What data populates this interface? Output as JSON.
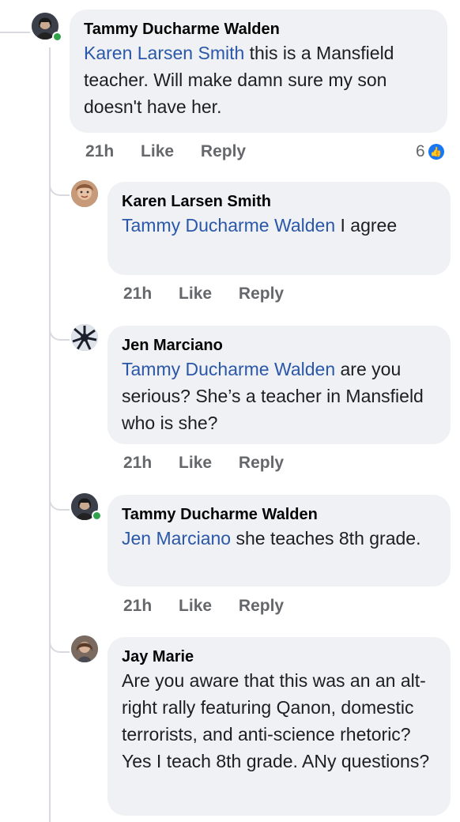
{
  "comments": [
    {
      "author": "Tammy Ducharme Walden",
      "mention": "Karen Larsen Smith",
      "text": " this is a Mansfield teacher. Will make damn sure my son doesn't have her.",
      "time": "21h",
      "like": "Like",
      "reply": "Reply",
      "reaction_count": "6",
      "online": true
    },
    {
      "author": "Karen Larsen Smith",
      "mention": "Tammy Ducharme Walden",
      "text": " I agree",
      "time": "21h",
      "like": "Like",
      "reply": "Reply"
    },
    {
      "author": "Jen Marciano",
      "mention": "Tammy Ducharme Walden",
      "text": " are you serious? She’s a teacher in Mansfield who is she?",
      "time": "21h",
      "like": "Like",
      "reply": "Reply"
    },
    {
      "author": "Tammy Ducharme Walden",
      "mention": "Jen Marciano",
      "text": " she teaches 8th grade.",
      "time": "21h",
      "like": "Like",
      "reply": "Reply",
      "online": true
    },
    {
      "author": "Jay Marie",
      "mention": "",
      "text": "Are you aware that this was an an alt-right rally featuring Qanon, domestic terrorists, and anti-science rhetoric? Yes I teach 8th grade. ANy questions?",
      "time": "",
      "like": "",
      "reply": ""
    }
  ],
  "icons": {
    "reaction": "like-icon",
    "avatar": "profile-avatar"
  },
  "colors": {
    "mention": "#2b57a9",
    "bubble": "#eff1f4",
    "meta": "#65676b",
    "like_badge": "#1877f2"
  }
}
